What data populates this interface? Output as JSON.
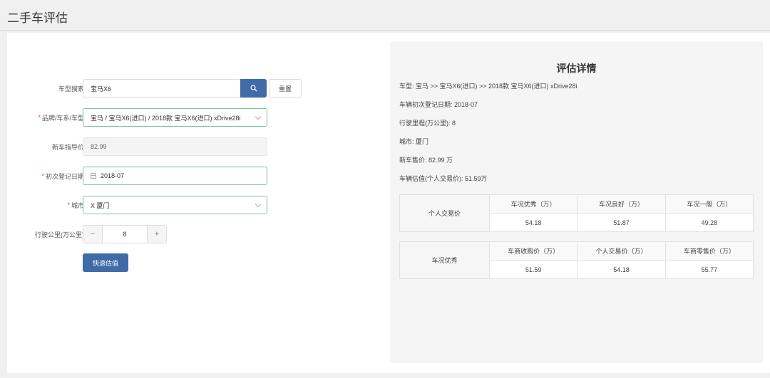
{
  "page": {
    "title": "二手车评估"
  },
  "form": {
    "model_search": {
      "label": "车型搜索",
      "value": "宝马X6",
      "reset_label": "重置"
    },
    "brand": {
      "label": "品牌/车系/车型",
      "value": "宝马 / 宝马X6(进口) / 2018款 宝马X6(进口) xDrive28i"
    },
    "msrp": {
      "label": "新车指导价",
      "value": "82.99"
    },
    "reg_date": {
      "label": "初次登记日期",
      "value": "2018-07"
    },
    "city": {
      "label": "城市",
      "value": "X 厦门"
    },
    "mileage": {
      "label": "行驶公里(万公里)",
      "value": "8",
      "minus": "−",
      "plus": "+"
    },
    "submit_label": "快速估值",
    "required_mark": "*"
  },
  "details": {
    "title": "评估详情",
    "lines": [
      "车型: 宝马 >> 宝马X6(进口) >> 2018款 宝马X6(进口) xDrive28i",
      "车辆初次登记日期: 2018-07",
      "行驶里程(万公里): 8",
      "城市: 厦门",
      "新车售价: 82.99 万",
      "车辆估值(个人交易价): 51.59万"
    ],
    "table1": {
      "side": "个人交易价",
      "headers": [
        "车况优秀（万）",
        "车况良好（万）",
        "车况一般（万）"
      ],
      "values": [
        "54.18",
        "51.87",
        "49.28"
      ]
    },
    "table2": {
      "side": "车况优秀",
      "headers": [
        "车商收购价（万）",
        "个人交易价（万）",
        "车商零售价（万）"
      ],
      "values": [
        "51.59",
        "54.18",
        "55.77"
      ]
    }
  }
}
